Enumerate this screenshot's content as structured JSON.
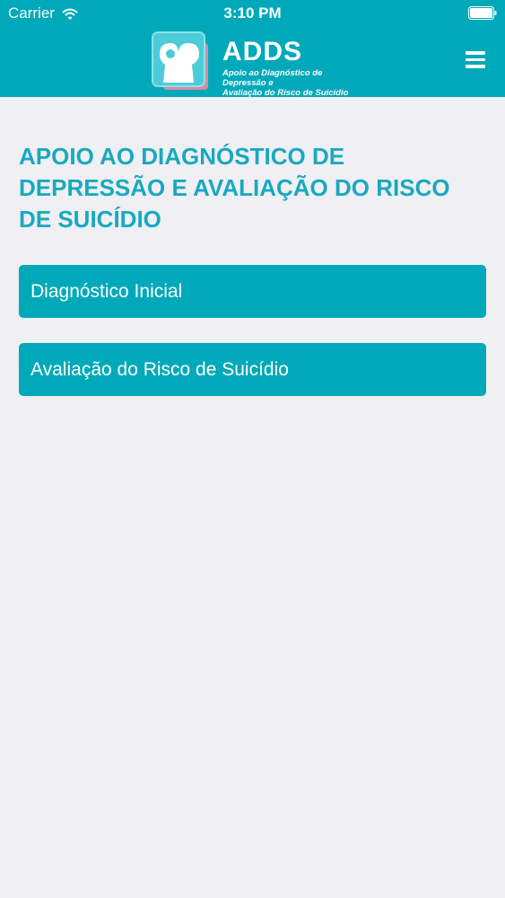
{
  "status_bar": {
    "carrier": "Carrier",
    "time": "3:10 PM",
    "wifi_icon": "wifi-icon",
    "battery_icon": "battery-icon"
  },
  "header": {
    "logo_title": "ADDS",
    "logo_subtitle_line1": "Apoio ao Diagnóstico de Depressão e",
    "logo_subtitle_line2": "Avaliação do Risco de Suicídio",
    "menu_icon": "hamburger-menu-icon",
    "background_color": "#00a9b9"
  },
  "main": {
    "title": "APOIO AO DIAGNÓSTICO DE DEPRESSÃO E AVALIAÇÃO DO RISCO DE SUICÍDIO",
    "buttons": [
      {
        "label": "Diagnóstico Inicial"
      },
      {
        "label": "Avaliação do Risco de Suicídio"
      }
    ],
    "title_color": "#19a9bf",
    "background_color": "#efeff4"
  }
}
